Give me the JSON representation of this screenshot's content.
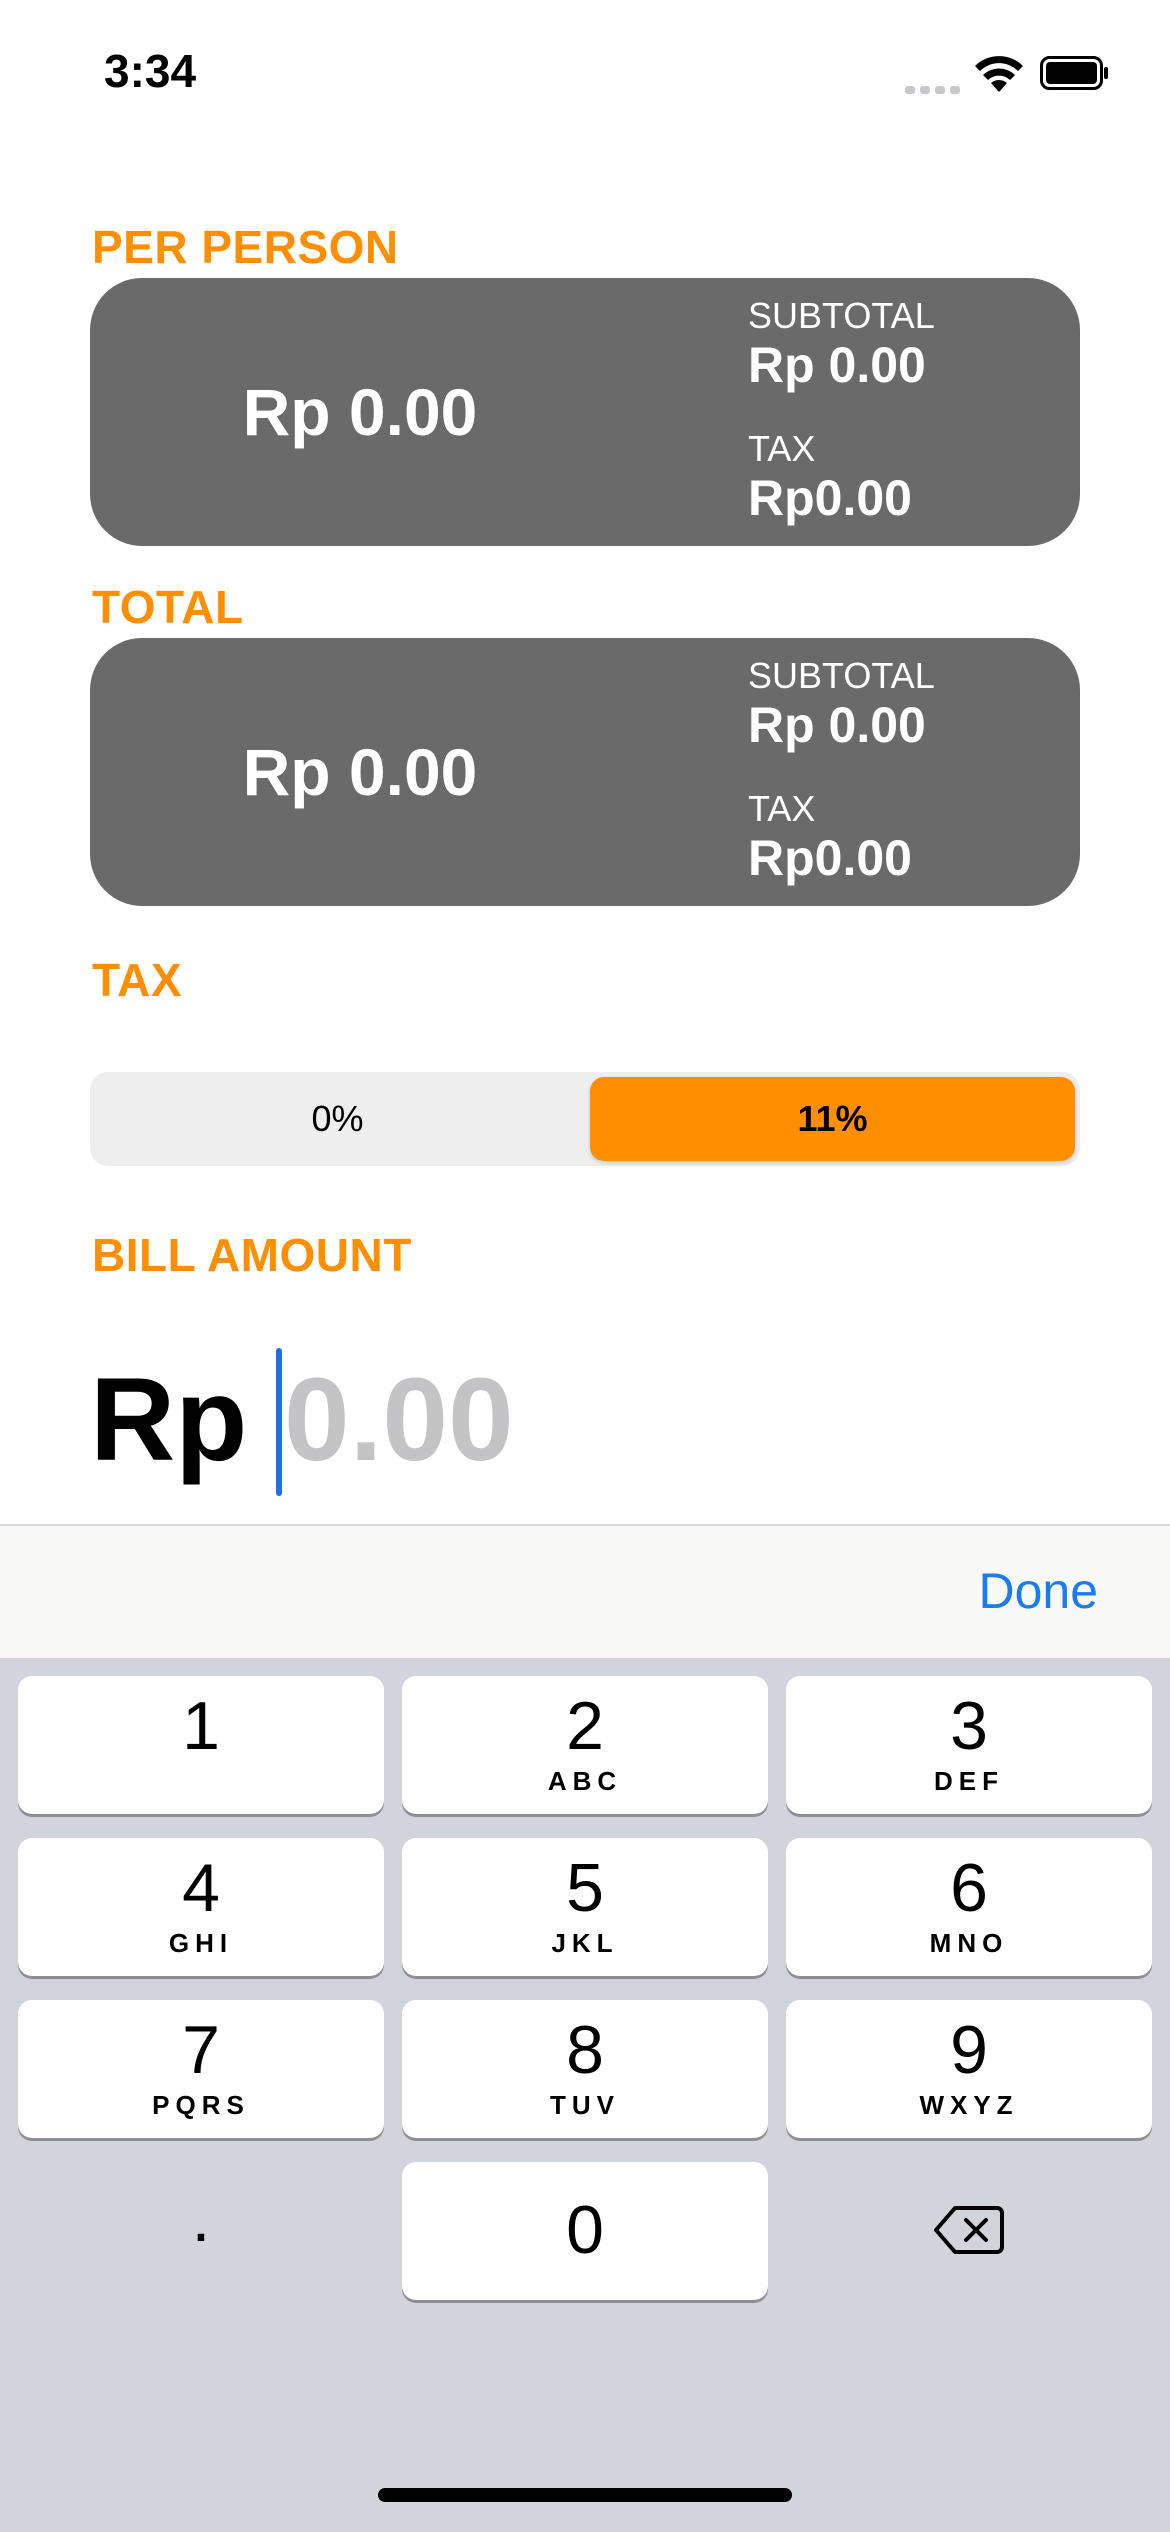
{
  "status_bar": {
    "time": "3:34"
  },
  "per_person": {
    "label": "PER PERSON",
    "amount": "Rp 0.00",
    "subtotal_label": "SUBTOTAL",
    "subtotal_value": "Rp 0.00",
    "tax_label": "TAX",
    "tax_value": "Rp0.00"
  },
  "total": {
    "label": "TOTAL",
    "amount": "Rp 0.00",
    "subtotal_label": "SUBTOTAL",
    "subtotal_value": "Rp 0.00",
    "tax_label": "TAX",
    "tax_value": "Rp0.00"
  },
  "tax": {
    "label": "TAX",
    "options": [
      "0%",
      "11%"
    ],
    "selected": "11%"
  },
  "bill": {
    "label": "BILL AMOUNT",
    "currency": "Rp",
    "value": "",
    "placeholder": "0.00"
  },
  "accessory": {
    "done_label": "Done"
  },
  "keypad": {
    "keys": [
      {
        "digit": "1",
        "letters": ""
      },
      {
        "digit": "2",
        "letters": "ABC"
      },
      {
        "digit": "3",
        "letters": "DEF"
      },
      {
        "digit": "4",
        "letters": "GHI"
      },
      {
        "digit": "5",
        "letters": "JKL"
      },
      {
        "digit": "6",
        "letters": "MNO"
      },
      {
        "digit": "7",
        "letters": "PQRS"
      },
      {
        "digit": "8",
        "letters": "TUV"
      },
      {
        "digit": "9",
        "letters": "WXYZ"
      },
      {
        "digit": ".",
        "letters": ""
      },
      {
        "digit": "0",
        "letters": ""
      }
    ],
    "delete_icon": "delete-backward-icon"
  },
  "colors": {
    "accent": "#ff8f00",
    "card": "#6a6a6a",
    "done": "#1b7cf0",
    "keyboard_bg": "#d1d4da"
  }
}
